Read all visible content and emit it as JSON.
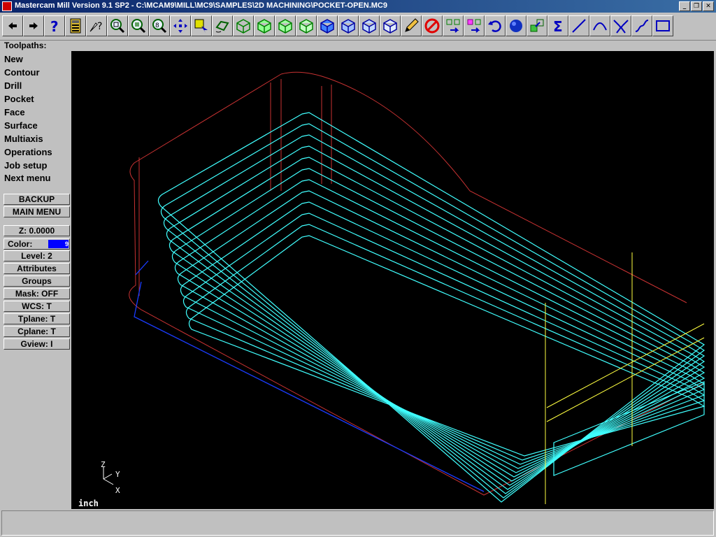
{
  "window": {
    "title": "Mastercam Mill Version 9.1 SP2 - C:\\MCAM9\\MILL\\MC9\\SAMPLES\\2D MACHINING\\POCKET-OPEN.MC9",
    "controls": [
      "minimize-icon",
      "restore-icon",
      "close-icon"
    ]
  },
  "toolbar": {
    "icons": [
      "arrow-left-icon",
      "arrow-right-icon",
      "help-icon",
      "calculator-icon",
      "analyze-icon",
      "zoom-icon",
      "unzoom-icon",
      "zoom-fit-icon",
      "pan-icon",
      "select-icon",
      "rotate-view-icon",
      "view-top-icon",
      "view-front-icon",
      "view-side-icon",
      "view-iso-icon",
      "cube-top-icon",
      "cube-front-icon",
      "cube-side-icon",
      "cube-iso-icon",
      "pencil-icon",
      "no-entry-icon",
      "transform-icon",
      "group-icon",
      "undo-icon",
      "sphere-icon",
      "shade-icon",
      "sum-icon",
      "line-icon",
      "arc-icon",
      "fillet-icon",
      "spline-icon",
      "rectangle-icon"
    ]
  },
  "prompt": "Toolpaths:",
  "menu": {
    "items": [
      "New",
      "Contour",
      "Drill",
      "Pocket",
      "Face",
      "Surface",
      "Multiaxis",
      "Operations",
      "Job setup",
      "Next menu"
    ],
    "backup": "BACKUP",
    "main_menu": "MAIN MENU",
    "z": "Z:  0.0000",
    "color_label": "Color:",
    "color_value": "9",
    "level": "Level:  2",
    "attributes": "Attributes",
    "groups": "Groups",
    "mask": "Mask:  OFF",
    "wcs": "WCS:   T",
    "tplane": "Tplane:  T",
    "cplane": "Cplane:  T",
    "gview": "Gview:   I"
  },
  "viewport": {
    "units": "inch",
    "axes": {
      "z": "Z",
      "y": "Y",
      "x": "X"
    }
  },
  "colors": {
    "title_gradient_start": "#0a246a",
    "title_gradient_end": "#3a6ea5",
    "geometry": "#c83232",
    "toolpath": "#40ffff",
    "blue_chain": "#1a3cff",
    "yellow": "#ffff40",
    "panel": "#c0c0c0"
  },
  "status": ""
}
